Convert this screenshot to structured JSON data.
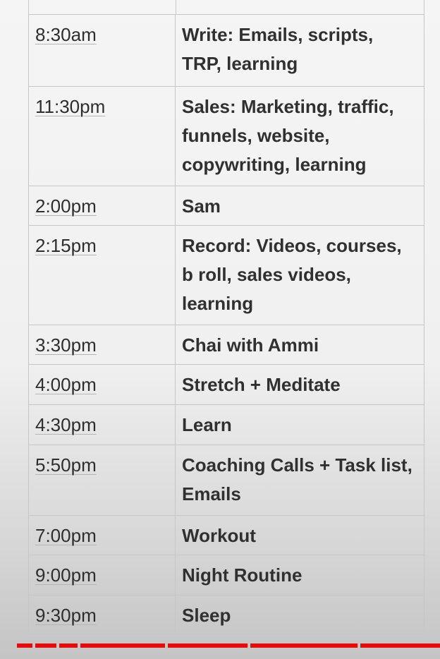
{
  "schedule": {
    "rows": [
      {
        "time": "8:30am",
        "task": "Write: Emails, scripts, TRP, learning"
      },
      {
        "time": "11:30pm",
        "task": "Sales: Marketing, traffic, funnels, website, copywriting, learning"
      },
      {
        "time": "2:00pm",
        "task": "Sam"
      },
      {
        "time": "2:15pm",
        "task": "Record: Videos, courses, b roll, sales videos, learning"
      },
      {
        "time": "3:30pm",
        "task": "Chai with Ammi"
      },
      {
        "time": "4:00pm",
        "task": "Stretch + Meditate"
      },
      {
        "time": "4:30pm",
        "task": "Learn"
      },
      {
        "time": "5:50pm",
        "task": "Coaching Calls + Task list, Emails"
      },
      {
        "time": "7:00pm",
        "task": "Workout"
      },
      {
        "time": "9:00pm",
        "task": "Night Routine"
      },
      {
        "time": "9:30pm",
        "task": "Sleep"
      }
    ]
  },
  "colors": {
    "progress_bar": "#e60a0a"
  }
}
